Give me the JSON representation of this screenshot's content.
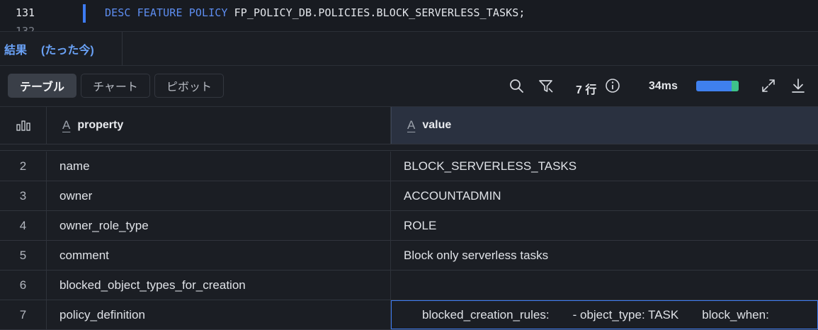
{
  "editor": {
    "current_line": "131",
    "next_line": "132",
    "code_kw1": "DESC FEATURE POLICY",
    "code_rest": " FP_POLICY_DB.POLICIES.BLOCK_SERVERLESS_TASKS;"
  },
  "results_tabs": {
    "label": "結果",
    "time": "(たった今)"
  },
  "toolbar": {
    "views": [
      "テーブル",
      "チャート",
      "ピボット"
    ],
    "active_view": "テーブル",
    "icons": [
      "search-icon",
      "filter-icon",
      "info-icon",
      "expand-icon",
      "download-icon"
    ],
    "rows": "7 行",
    "duration": "34ms",
    "progress": {
      "primary_fraction": 0.83,
      "secondary_fraction": 0.17,
      "primary_color": "#3f80ee",
      "secondary_color": "#3ec28a"
    }
  },
  "table": {
    "columns": [
      "property",
      "value"
    ],
    "column_type_icon": "A",
    "rows": [
      {
        "idx": "2",
        "property": "name",
        "value": "BLOCK_SERVERLESS_TASKS"
      },
      {
        "idx": "3",
        "property": "owner",
        "value": "ACCOUNTADMIN"
      },
      {
        "idx": "4",
        "property": "owner_role_type",
        "value": "ROLE"
      },
      {
        "idx": "5",
        "property": "comment",
        "value": "Block only serverless tasks"
      },
      {
        "idx": "6",
        "property": "blocked_object_types_for_creation",
        "value": ""
      },
      {
        "idx": "7",
        "property": "policy_definition",
        "value": "blocked_creation_rules:       - object_type: TASK       block_when:"
      }
    ]
  },
  "colors": {
    "accent": "#3d7bf2",
    "tab_text": "#6aa2f7",
    "keyword": "#5d8df0"
  }
}
